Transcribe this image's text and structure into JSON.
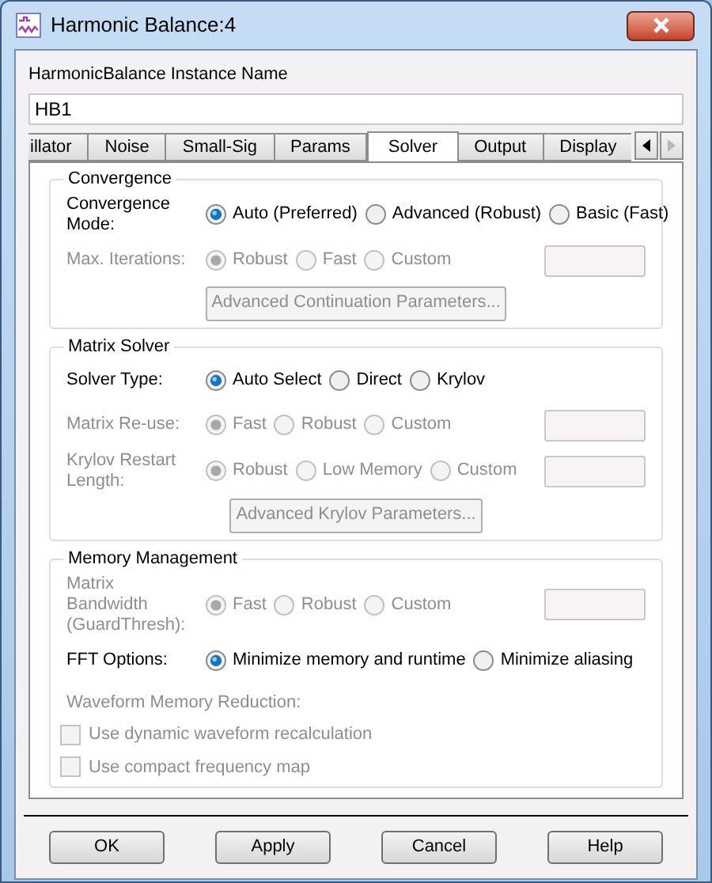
{
  "window": {
    "title": "Harmonic Balance:4"
  },
  "instance_name": {
    "label": "HarmonicBalance Instance Name",
    "value": "HB1"
  },
  "tabs": [
    {
      "label": "illator",
      "selected": false
    },
    {
      "label": "Noise",
      "selected": false
    },
    {
      "label": "Small-Sig",
      "selected": false
    },
    {
      "label": "Params",
      "selected": false
    },
    {
      "label": "Solver",
      "selected": true
    },
    {
      "label": "Output",
      "selected": false
    },
    {
      "label": "Display",
      "selected": false
    }
  ],
  "tab_scroll": [
    {
      "disabled": false
    },
    {
      "disabled": true
    }
  ],
  "groups": [
    {
      "title": "Convergence",
      "rows": [
        {
          "kind": "radio",
          "label": "Convergence Mode:",
          "disabled": false,
          "options": [
            {
              "label": "Auto (Preferred)",
              "selected": true
            },
            {
              "label": "Advanced (Robust)",
              "selected": false
            },
            {
              "label": "Basic (Fast)",
              "selected": false
            }
          ]
        },
        {
          "kind": "radio",
          "label": "Max. Iterations:",
          "disabled": true,
          "options": [
            {
              "label": "Robust",
              "selected": true
            },
            {
              "label": "Fast",
              "selected": false
            },
            {
              "label": "Custom",
              "selected": false
            }
          ],
          "input": {
            "disabled": true
          }
        },
        {
          "kind": "button",
          "label": "Advanced Continuation Parameters...",
          "disabled": true
        }
      ]
    },
    {
      "title": "Matrix Solver",
      "rows": [
        {
          "kind": "radio",
          "label": "Solver Type:",
          "disabled": false,
          "options": [
            {
              "label": "Auto Select",
              "selected": true
            },
            {
              "label": "Direct",
              "selected": false
            },
            {
              "label": "Krylov",
              "selected": false
            }
          ]
        },
        {
          "kind": "radio",
          "label": "Matrix Re-use:",
          "disabled": true,
          "options": [
            {
              "label": "Fast",
              "selected": true
            },
            {
              "label": "Robust",
              "selected": false
            },
            {
              "label": "Custom",
              "selected": false
            }
          ],
          "input": {
            "disabled": true
          }
        },
        {
          "kind": "radio",
          "label": "Krylov Restart Length:",
          "disabled": true,
          "options": [
            {
              "label": "Robust",
              "selected": true
            },
            {
              "label": "Low Memory",
              "selected": false
            },
            {
              "label": "Custom",
              "selected": false
            }
          ],
          "input": {
            "disabled": true
          }
        },
        {
          "kind": "button",
          "label": "Advanced Krylov Parameters...",
          "disabled": true
        }
      ]
    },
    {
      "title": "Memory Management",
      "rows": [
        {
          "kind": "radio",
          "label": "Matrix Bandwidth (GuardThresh):",
          "disabled": true,
          "options": [
            {
              "label": "Fast",
              "selected": true
            },
            {
              "label": "Robust",
              "selected": false
            },
            {
              "label": "Custom",
              "selected": false
            }
          ],
          "input": {
            "disabled": true
          }
        },
        {
          "kind": "radio",
          "label": "FFT Options:",
          "disabled": false,
          "options": [
            {
              "label": "Minimize memory and runtime",
              "selected": true
            },
            {
              "label": "Minimize aliasing",
              "selected": false
            }
          ]
        },
        {
          "kind": "caption",
          "label": "Waveform Memory Reduction:",
          "disabled": true
        },
        {
          "kind": "checkbox",
          "label": "Use dynamic waveform recalculation",
          "checked": false,
          "disabled": true
        },
        {
          "kind": "checkbox",
          "label": "Use compact frequency map",
          "checked": false,
          "disabled": true
        }
      ]
    }
  ],
  "buttons": [
    "OK",
    "Apply",
    "Cancel",
    "Help"
  ]
}
